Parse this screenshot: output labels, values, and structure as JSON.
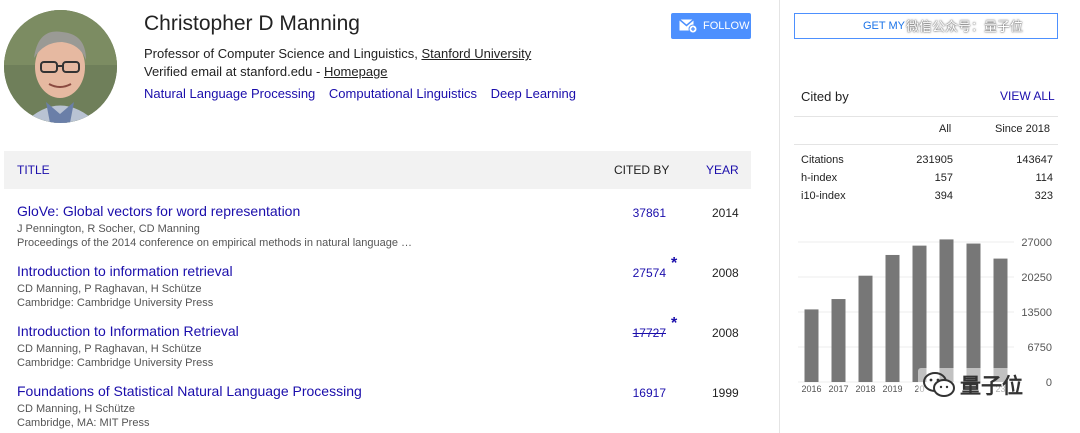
{
  "profile": {
    "name": "Christopher D Manning",
    "affiliation_prefix": "Professor of Computer Science and Linguistics, ",
    "affiliation_org": "Stanford University",
    "email_prefix": "Verified email at stanford.edu - ",
    "homepage_label": "Homepage",
    "topics": [
      "Natural Language Processing",
      "Computational Linguistics",
      "Deep Learning"
    ]
  },
  "buttons": {
    "follow_label": "FOLLOW",
    "get_my_label": "GET MY"
  },
  "watermark": {
    "top_text": "微信公众号：量子位",
    "bottom_text": "量子位"
  },
  "table": {
    "col_title": "TITLE",
    "col_cited": "CITED BY",
    "col_year": "YEAR",
    "rows": [
      {
        "title": "GloVe: Global vectors for word representation",
        "authors": "J Pennington, R Socher, CD Manning",
        "venue": "Proceedings of the 2014 conference on empirical methods in natural language …",
        "cited": "37861",
        "star": "",
        "year": "2014"
      },
      {
        "title": "Introduction to information retrieval",
        "authors": "CD Manning, P Raghavan, H Schütze",
        "venue": "Cambridge: Cambridge University Press",
        "cited": "27574",
        "star": "*",
        "year": "2008"
      },
      {
        "title": "Introduction to Information Retrieval",
        "authors": "CD Manning, P Raghavan, H Schütze",
        "venue": "Cambridge: Cambridge University Press",
        "cited": "17727",
        "star": "*",
        "year": "2008"
      },
      {
        "title": "Foundations of Statistical Natural Language Processing",
        "authors": "CD Manning, H Schütze",
        "venue": "Cambridge, MA: MIT Press",
        "cited": "16917",
        "star": "",
        "year": "1999"
      }
    ]
  },
  "cited_by": {
    "label": "Cited by",
    "view_all": "VIEW ALL",
    "col_all": "All",
    "col_since": "Since 2018",
    "stats": [
      {
        "label": "Citations",
        "all": "231905",
        "since": "143647"
      },
      {
        "label": "h-index",
        "all": "157",
        "since": "114"
      },
      {
        "label": "i10-index",
        "all": "394",
        "since": "323"
      }
    ]
  },
  "chart_data": {
    "type": "bar",
    "categories": [
      "2016",
      "2017",
      "2018",
      "2019",
      "2020",
      "2021",
      "2022",
      "2023"
    ],
    "category_labels_shown": [
      "2016",
      "2017",
      "2018",
      "2019",
      "20",
      "",
      "",
      "23"
    ],
    "values": [
      14000,
      16000,
      20500,
      24500,
      26300,
      27500,
      26700,
      23800
    ],
    "yticks": [
      "27000",
      "20250",
      "13500",
      "6750",
      "0"
    ],
    "ylim": [
      0,
      27000
    ],
    "bar_color": "#777777"
  }
}
